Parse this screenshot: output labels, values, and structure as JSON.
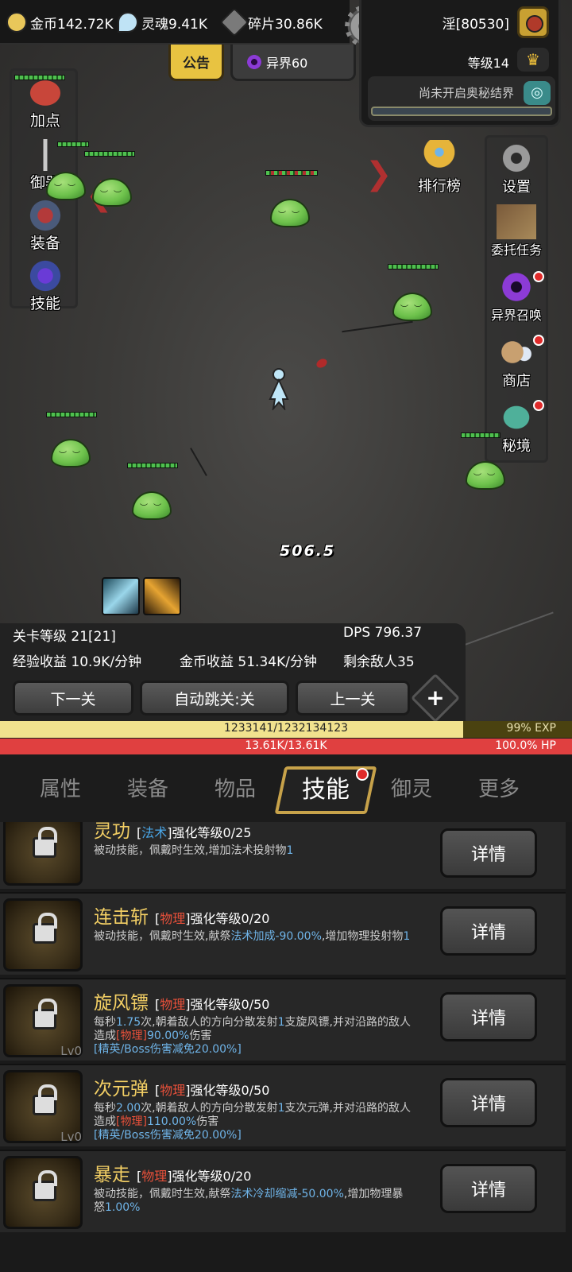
{
  "resources": {
    "gold": "金币142.72K",
    "soul": "灵魂9.41K",
    "shard": "碎片30.86K"
  },
  "notice_label": "公告",
  "otherworld_label": "异界60",
  "player": {
    "name": "淫[80530]",
    "level": "等级14",
    "secret_realm": "尚未开启奥秘结界"
  },
  "left_menu": [
    "加点",
    "御器",
    "装备",
    "技能"
  ],
  "right_menu": [
    "排行榜",
    "设置",
    "委托任务",
    "异界召唤",
    "商店",
    "秘境"
  ],
  "damage_popup": "506.5",
  "stats": {
    "stage_level": "关卡等级 21[21]",
    "dps": "DPS  796.37",
    "exp_income": "经验收益 10.9K/分钟",
    "gold_income": "金币收益 51.34K/分钟",
    "enemies_left": "剩余敌人35"
  },
  "buttons": {
    "next": "下一关",
    "auto": "自动跳关:关",
    "prev": "上一关"
  },
  "exp": {
    "text": "1233141/1232134123",
    "percent": "99%  EXP",
    "fill": 0.81
  },
  "hp": {
    "text": "13.61K/13.61K",
    "percent": "100.0%   HP",
    "fill": 1.0
  },
  "tabs": [
    "属性",
    "装备",
    "物品",
    "技能",
    "御灵",
    "更多"
  ],
  "active_tab": "技能",
  "skills": [
    {
      "name": "灵功",
      "tag": "法术",
      "tag_type": "mag",
      "upgrade": "强化等级0/25",
      "desc": [
        "被动技能，佩戴时生效,增加法术投射物",
        "1"
      ],
      "level": "",
      "detail": "详情"
    },
    {
      "name": "连击斩",
      "tag": "物理",
      "tag_type": "phy",
      "upgrade": "强化等级0/20",
      "desc": [
        "被动技能，佩戴时生效,献祭",
        "法术加成-90.00%",
        ",增加物理投射物",
        "1"
      ],
      "level": "",
      "detail": "详情"
    },
    {
      "name": "旋风镖",
      "tag": "物理",
      "tag_type": "phy",
      "upgrade": "强化等级0/50",
      "desc": [
        "每秒",
        "1.75",
        "次,朝着敌人的方向分散发射",
        "1",
        "支旋风镖,并对沿路的敌人造成",
        "[物理]",
        "90.00%",
        "伤害",
        "[精英/Boss伤害减免20.00%]"
      ],
      "level": "Lv0",
      "detail": "详情"
    },
    {
      "name": "次元弹",
      "tag": "物理",
      "tag_type": "phy",
      "upgrade": "强化等级0/50",
      "desc": [
        "每秒",
        "2.00",
        "次,朝着敌人的方向分散发射",
        "1",
        "支次元弹,并对沿路的敌人造成",
        "[物理]",
        "110.00%",
        "伤害",
        "[精英/Boss伤害减免20.00%]"
      ],
      "level": "Lv0",
      "detail": "详情"
    },
    {
      "name": "暴走",
      "tag": "物理",
      "tag_type": "phy",
      "upgrade": "强化等级0/20",
      "desc": [
        "被动技能，佩戴时生效,献祭",
        "法术冷却缩减-50.00%",
        ",增加物理暴怒",
        "1.00%"
      ],
      "level": "",
      "detail": "详情"
    }
  ]
}
